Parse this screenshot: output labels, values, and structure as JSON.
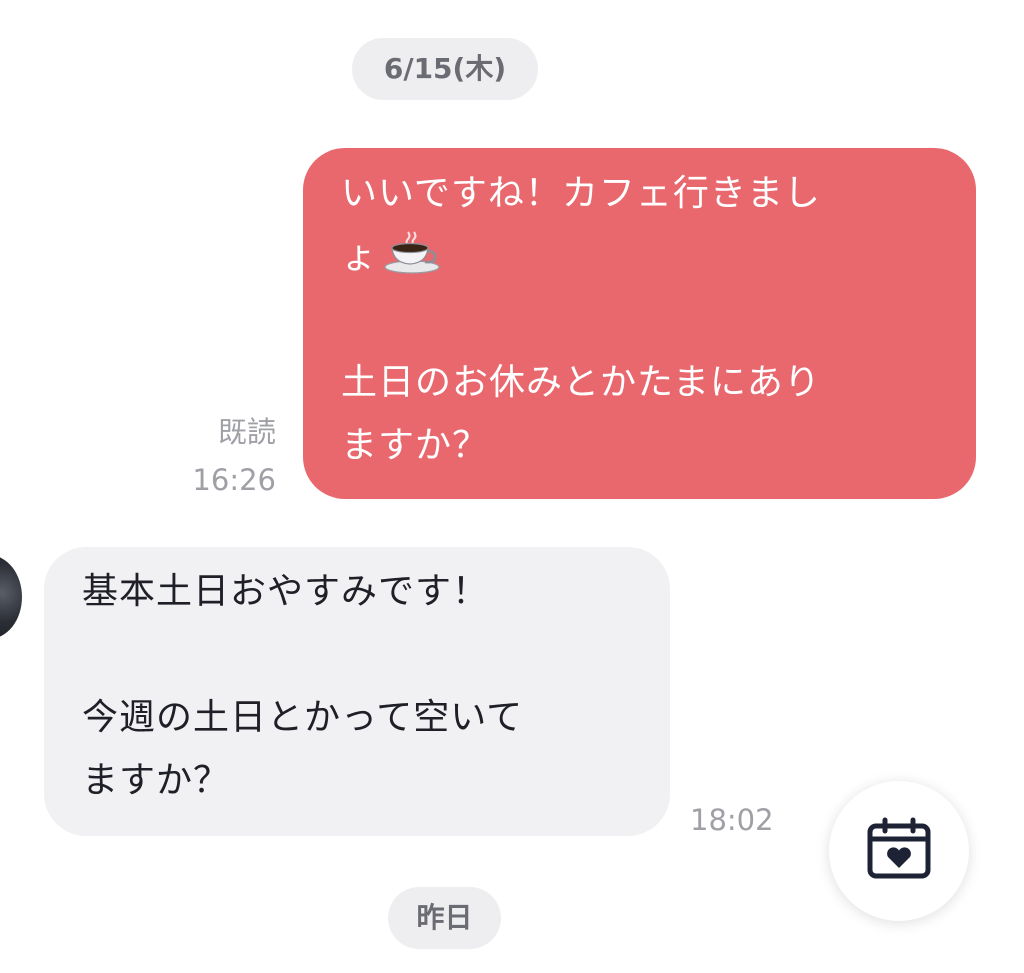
{
  "dates": {
    "top": "6/15(木)",
    "bottom": "昨日"
  },
  "messages": [
    {
      "side": "sent",
      "lines": [
        "いいですね！カフェ行きまし",
        "ょ",
        "",
        "土日のお休みとかたまにあり",
        "ますか？"
      ],
      "emoji": "coffee-cup",
      "read_label": "既読",
      "time": "16:26"
    },
    {
      "side": "received",
      "lines": [
        "基本土日おやすみです！",
        "",
        "今週の土日とかって空いて",
        "ますか？"
      ],
      "time": "18:02"
    }
  ],
  "fab": {
    "icon": "calendar-heart-icon"
  },
  "colors": {
    "sent_bubble": "#e8686e",
    "received_bubble": "#f1f1f3",
    "date_pill": "#eeeef0",
    "meta_text": "#9fa0a6",
    "icon": "#1e2235"
  }
}
